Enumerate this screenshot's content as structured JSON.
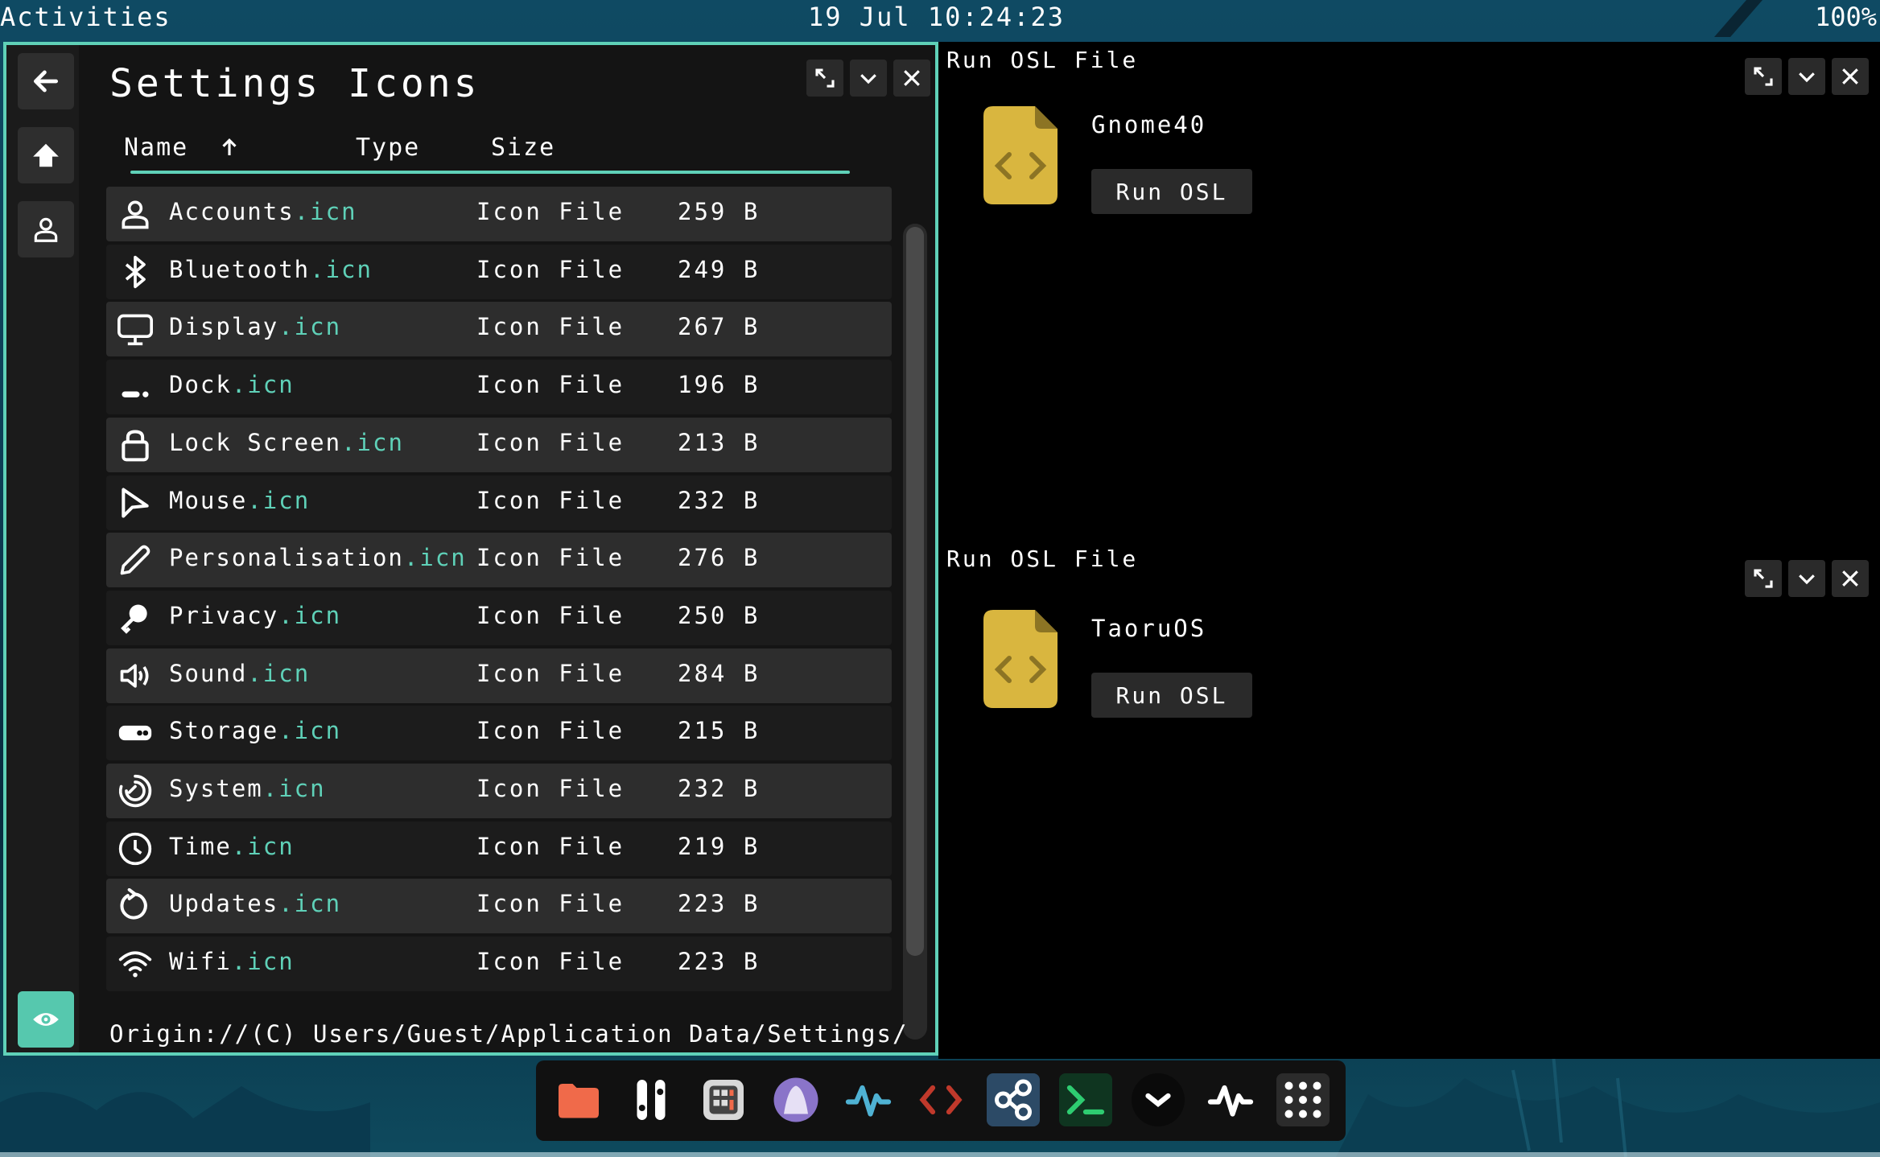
{
  "topbar": {
    "activities": "Activities",
    "clock": "19  Jul  10:24:23",
    "battery": "100%"
  },
  "files_window": {
    "title": "Settings  Icons",
    "columns": {
      "name": "Name",
      "type": "Type",
      "size": "Size"
    },
    "sort": "name-ascending",
    "rows": [
      {
        "name": "Accounts",
        "ext": ".icn",
        "type": "Icon  File",
        "size": "259  B",
        "icon": "person-icon"
      },
      {
        "name": "Bluetooth",
        "ext": ".icn",
        "type": "Icon  File",
        "size": "249  B",
        "icon": "bluetooth-icon"
      },
      {
        "name": "Display",
        "ext": ".icn",
        "type": "Icon  File",
        "size": "267  B",
        "icon": "monitor-icon"
      },
      {
        "name": "Dock",
        "ext": ".icn",
        "type": "Icon  File",
        "size": "196  B",
        "icon": "dock-icon"
      },
      {
        "name": "Lock  Screen",
        "ext": ".icn",
        "type": "Icon  File",
        "size": "213  B",
        "icon": "lock-icon"
      },
      {
        "name": "Mouse",
        "ext": ".icn",
        "type": "Icon  File",
        "size": "232  B",
        "icon": "pointer-icon"
      },
      {
        "name": "Personalisation",
        "ext": ".icn",
        "type": "Icon  File",
        "size": "276  B",
        "icon": "pencil-icon"
      },
      {
        "name": "Privacy",
        "ext": ".icn",
        "type": "Icon  File",
        "size": "250  B",
        "icon": "key-icon"
      },
      {
        "name": "Sound",
        "ext": ".icn",
        "type": "Icon  File",
        "size": "284  B",
        "icon": "speaker-icon"
      },
      {
        "name": "Storage",
        "ext": ".icn",
        "type": "Icon  File",
        "size": "215  B",
        "icon": "storage-icon"
      },
      {
        "name": "System",
        "ext": ".icn",
        "type": "Icon  File",
        "size": "232  B",
        "icon": "system-icon"
      },
      {
        "name": "Time",
        "ext": ".icn",
        "type": "Icon  File",
        "size": "219  B",
        "icon": "clock-icon"
      },
      {
        "name": "Updates",
        "ext": ".icn",
        "type": "Icon  File",
        "size": "223  B",
        "icon": "refresh-icon"
      },
      {
        "name": "Wifi",
        "ext": ".icn",
        "type": "Icon  File",
        "size": "223  B",
        "icon": "wifi-icon"
      }
    ],
    "origin": "Origin://(C)  Users/Guest/Application  Data/Settings/"
  },
  "osl_windows": [
    {
      "title": "Run  OSL  File",
      "file_name": "Gnome40",
      "button": "Run  OSL"
    },
    {
      "title": "Run  OSL  File",
      "file_name": "TaoruOS",
      "button": "Run  OSL"
    }
  ],
  "dock": {
    "items": [
      "files-icon",
      "settings-icon",
      "calculator-icon",
      "browser-icon",
      "activity-icon",
      "code-icon",
      "nodes-icon",
      "terminal-icon",
      "chevron-icon",
      "monitor-icon",
      "app-grid-icon"
    ]
  },
  "colors": {
    "accent": "#5fd1b8",
    "folder_yellow": "#d9b63f",
    "row_alt": "#2d2d2d",
    "row_base": "#1c1c1c"
  }
}
